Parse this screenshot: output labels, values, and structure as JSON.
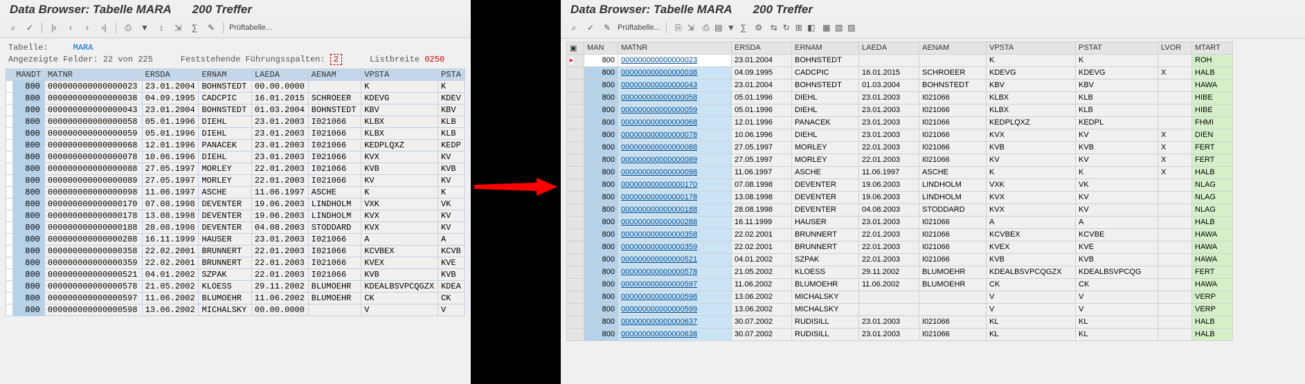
{
  "title_main": "Data Browser: Tabelle MARA",
  "title_hits": "200 Treffer",
  "left": {
    "toolbar": {
      "glasses": "⌕",
      "check": "✓",
      "first": "|‹",
      "prev": "‹",
      "next": "›",
      "last": "›|",
      "print": "⎙",
      "filter": "▼",
      "sort": "↕",
      "export": "⇲",
      "calc": "∑",
      "wrench": "✎",
      "pruef": "Prüftabelle..."
    },
    "meta": {
      "tabelle_lbl": "Tabelle:",
      "tabelle_val": "MARA",
      "felder_lbl": "Angezeigte Felder: 22 von 225",
      "fix_lbl": "Feststehende Führungsspalten:",
      "fix_val": "2",
      "breite_lbl": "Listbreite",
      "breite_val": "0250"
    },
    "cols": [
      "",
      "MANDT",
      "MATNR",
      "ERSDA",
      "ERNAM",
      "LAEDA",
      "AENAM",
      "VPSTA",
      "PSTA"
    ],
    "rows": [
      [
        "800",
        "000000000000000023",
        "23.01.2004",
        "BOHNSTEDT",
        "00.00.0000",
        "",
        "K",
        "K"
      ],
      [
        "800",
        "000000000000000038",
        "04.09.1995",
        "CADCPIC",
        "16.01.2015",
        "SCHROEER",
        "KDEVG",
        "KDEV"
      ],
      [
        "800",
        "000000000000000043",
        "23.01.2004",
        "BOHNSTEDT",
        "01.03.2004",
        "BOHNSTEDT",
        "KBV",
        "KBV"
      ],
      [
        "800",
        "000000000000000058",
        "05.01.1996",
        "DIEHL",
        "23.01.2003",
        "I021066",
        "KLBX",
        "KLB"
      ],
      [
        "800",
        "000000000000000059",
        "05.01.1996",
        "DIEHL",
        "23.01.2003",
        "I021066",
        "KLBX",
        "KLB"
      ],
      [
        "800",
        "000000000000000068",
        "12.01.1996",
        "PANACEK",
        "23.01.2003",
        "I021066",
        "KEDPLQXZ",
        "KEDP"
      ],
      [
        "800",
        "000000000000000078",
        "10.06.1996",
        "DIEHL",
        "23.01.2003",
        "I021066",
        "KVX",
        "KV"
      ],
      [
        "800",
        "000000000000000088",
        "27.05.1997",
        "MORLEY",
        "22.01.2003",
        "I021066",
        "KVB",
        "KVB"
      ],
      [
        "800",
        "000000000000000089",
        "27.05.1997",
        "MORLEY",
        "22.01.2003",
        "I021066",
        "KV",
        "KV"
      ],
      [
        "800",
        "000000000000000098",
        "11.06.1997",
        "ASCHE",
        "11.06.1997",
        "ASCHE",
        "K",
        "K"
      ],
      [
        "800",
        "000000000000000170",
        "07.08.1998",
        "DEVENTER",
        "19.06.2003",
        "LINDHOLM",
        "VXK",
        "VK"
      ],
      [
        "800",
        "000000000000000178",
        "13.08.1998",
        "DEVENTER",
        "19.06.2003",
        "LINDHOLM",
        "KVX",
        "KV"
      ],
      [
        "800",
        "000000000000000188",
        "28.08.1998",
        "DEVENTER",
        "04.08.2003",
        "STODDARD",
        "KVX",
        "KV"
      ],
      [
        "800",
        "000000000000000288",
        "16.11.1999",
        "HAUSER",
        "23.01.2003",
        "I021066",
        "A",
        "A"
      ],
      [
        "800",
        "000000000000000358",
        "22.02.2001",
        "BRUNNERT",
        "22.01.2003",
        "I021066",
        "KCVBEX",
        "KCVB"
      ],
      [
        "800",
        "000000000000000359",
        "22.02.2001",
        "BRUNNERT",
        "22.01.2003",
        "I021066",
        "KVEX",
        "KVE"
      ],
      [
        "800",
        "000000000000000521",
        "04.01.2002",
        "SZPAK",
        "22.01.2003",
        "I021066",
        "KVB",
        "KVB"
      ],
      [
        "800",
        "000000000000000578",
        "21.05.2002",
        "KLOESS",
        "29.11.2002",
        "BLUMOEHR",
        "KDEALBSVPCQGZX",
        "KDEA"
      ],
      [
        "800",
        "000000000000000597",
        "11.06.2002",
        "BLUMOEHR",
        "11.06.2002",
        "BLUMOEHR",
        "CK",
        "CK"
      ],
      [
        "800",
        "000000000000000598",
        "13.06.2002",
        "MICHALSKY",
        "00.00.0000",
        "",
        "V",
        "V"
      ]
    ]
  },
  "right": {
    "toolbar": {
      "glasses": "⌕",
      "check": "✓",
      "wrench": "✎",
      "pruef": "Prüftabelle...",
      "icons": [
        "⎘",
        "⇲",
        "⎙",
        "▤",
        "▼",
        "∑",
        "⚙",
        "⇆",
        "↻",
        "⊞",
        "◧",
        "▦",
        "▧",
        "▨"
      ]
    },
    "cols": [
      "",
      "MAN",
      "MATNR",
      "ERSDA",
      "ERNAM",
      "LAEDA",
      "AENAM",
      "VPSTA",
      "PSTAT",
      "LVOR",
      "MTART"
    ],
    "rows": [
      [
        "800",
        "000000000000000023",
        "23.01.2004",
        "BOHNSTEDT",
        "",
        "",
        "K",
        "K",
        "",
        "ROH"
      ],
      [
        "800",
        "000000000000000038",
        "04.09.1995",
        "CADCPIC",
        "16.01.2015",
        "SCHROEER",
        "KDEVG",
        "KDEVG",
        "X",
        "HALB"
      ],
      [
        "800",
        "000000000000000043",
        "23.01.2004",
        "BOHNSTEDT",
        "01.03.2004",
        "BOHNSTEDT",
        "KBV",
        "KBV",
        "",
        "HAWA"
      ],
      [
        "800",
        "000000000000000058",
        "05.01.1996",
        "DIEHL",
        "23.01.2003",
        "I021066",
        "KLBX",
        "KLB",
        "",
        "HIBE"
      ],
      [
        "800",
        "000000000000000059",
        "05.01.1996",
        "DIEHL",
        "23.01.2003",
        "I021066",
        "KLBX",
        "KLB",
        "",
        "HIBE"
      ],
      [
        "800",
        "000000000000000068",
        "12.01.1996",
        "PANACEK",
        "23.01.2003",
        "I021066",
        "KEDPLQXZ",
        "KEDPL",
        "",
        "FHMI"
      ],
      [
        "800",
        "000000000000000078",
        "10.06.1996",
        "DIEHL",
        "23.01.2003",
        "I021066",
        "KVX",
        "KV",
        "X",
        "DIEN"
      ],
      [
        "800",
        "000000000000000088",
        "27.05.1997",
        "MORLEY",
        "22.01.2003",
        "I021066",
        "KVB",
        "KVB",
        "X",
        "FERT"
      ],
      [
        "800",
        "000000000000000089",
        "27.05.1997",
        "MORLEY",
        "22.01.2003",
        "I021066",
        "KV",
        "KV",
        "X",
        "FERT"
      ],
      [
        "800",
        "000000000000000098",
        "11.06.1997",
        "ASCHE",
        "11.06.1997",
        "ASCHE",
        "K",
        "K",
        "X",
        "HALB"
      ],
      [
        "800",
        "000000000000000170",
        "07.08.1998",
        "DEVENTER",
        "19.06.2003",
        "LINDHOLM",
        "VXK",
        "VK",
        "",
        "NLAG"
      ],
      [
        "800",
        "000000000000000178",
        "13.08.1998",
        "DEVENTER",
        "19.06.2003",
        "LINDHOLM",
        "KVX",
        "KV",
        "",
        "NLAG"
      ],
      [
        "800",
        "000000000000000188",
        "28.08.1998",
        "DEVENTER",
        "04.08.2003",
        "STODDARD",
        "KVX",
        "KV",
        "",
        "NLAG"
      ],
      [
        "800",
        "000000000000000288",
        "16.11.1999",
        "HAUSER",
        "23.01.2003",
        "I021066",
        "A",
        "A",
        "",
        "HALB"
      ],
      [
        "800",
        "000000000000000358",
        "22.02.2001",
        "BRUNNERT",
        "22.01.2003",
        "I021066",
        "KCVBEX",
        "KCVBE",
        "",
        "HAWA"
      ],
      [
        "800",
        "000000000000000359",
        "22.02.2001",
        "BRUNNERT",
        "22.01.2003",
        "I021066",
        "KVEX",
        "KVE",
        "",
        "HAWA"
      ],
      [
        "800",
        "000000000000000521",
        "04.01.2002",
        "SZPAK",
        "22.01.2003",
        "I021066",
        "KVB",
        "KVB",
        "",
        "HAWA"
      ],
      [
        "800",
        "000000000000000578",
        "21.05.2002",
        "KLOESS",
        "29.11.2002",
        "BLUMOEHR",
        "KDEALBSVPCQGZX",
        "KDEALBSVPCQG",
        "",
        "FERT"
      ],
      [
        "800",
        "000000000000000597",
        "11.06.2002",
        "BLUMOEHR",
        "11.06.2002",
        "BLUMOEHR",
        "CK",
        "CK",
        "",
        "HAWA"
      ],
      [
        "800",
        "000000000000000598",
        "13.06.2002",
        "MICHALSKY",
        "",
        "",
        "V",
        "V",
        "",
        "VERP"
      ],
      [
        "800",
        "000000000000000599",
        "13.06.2002",
        "MICHALSKY",
        "",
        "",
        "V",
        "V",
        "",
        "VERP"
      ],
      [
        "800",
        "000000000000000637",
        "30.07.2002",
        "RUDISILL",
        "23.01.2003",
        "I021066",
        "KL",
        "KL",
        "",
        "HALB"
      ],
      [
        "800",
        "000000000000000638",
        "30.07.2002",
        "RUDISILL",
        "23.01.2003",
        "I021066",
        "KL",
        "KL",
        "",
        "HALB"
      ]
    ]
  }
}
